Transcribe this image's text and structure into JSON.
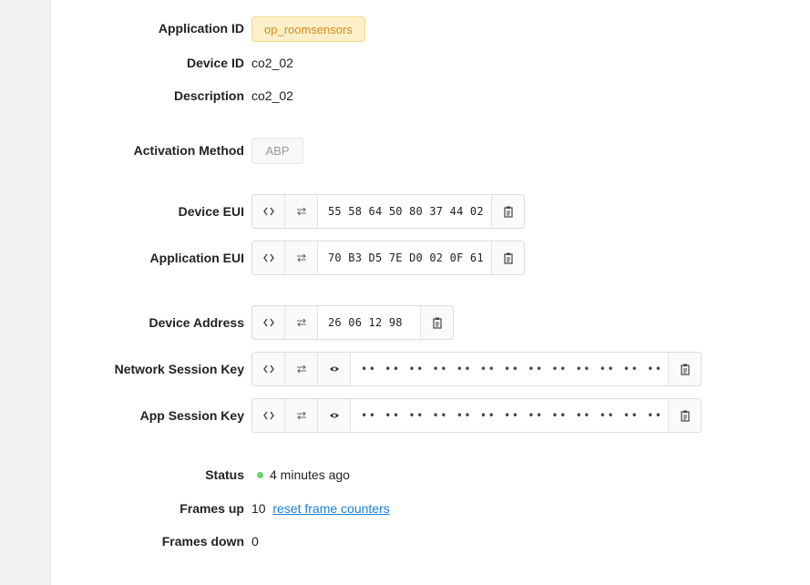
{
  "labels": {
    "application_id": "Application ID",
    "device_id": "Device ID",
    "description": "Description",
    "activation_method": "Activation Method",
    "device_eui": "Device EUI",
    "application_eui": "Application EUI",
    "device_address": "Device Address",
    "network_session_key": "Network Session Key",
    "app_session_key": "App Session Key",
    "status": "Status",
    "frames_up": "Frames up",
    "frames_down": "Frames down"
  },
  "values": {
    "application_id": "op_roomsensors",
    "device_id": "co2_02",
    "description": "co2_02",
    "activation_method": "ABP",
    "device_eui": "55 58 64 50 80 37 44 02",
    "application_eui": "70 B3 D5 7E D0 02 0F 61",
    "device_address": "26 06 12 98",
    "network_session_key": "•• •• •• •• •• •• •• •• •• •• •• •• •• •• •• ••",
    "app_session_key": "•• •• •• •• •• •• •• •• •• •• •• •• •• •• •• ••",
    "status": "4 minutes ago",
    "frames_up": "10",
    "reset_link": "reset frame counters",
    "frames_down": "0"
  },
  "icons": {
    "code": "code-brackets-icon",
    "swap": "swap-arrows-icon",
    "eye": "eye-icon",
    "copy": "clipboard-icon"
  },
  "colors": {
    "status_online": "#62d96b",
    "link": "#1a7fd6",
    "app_badge_bg": "#fdf0c8",
    "app_badge_text": "#d78a18"
  }
}
